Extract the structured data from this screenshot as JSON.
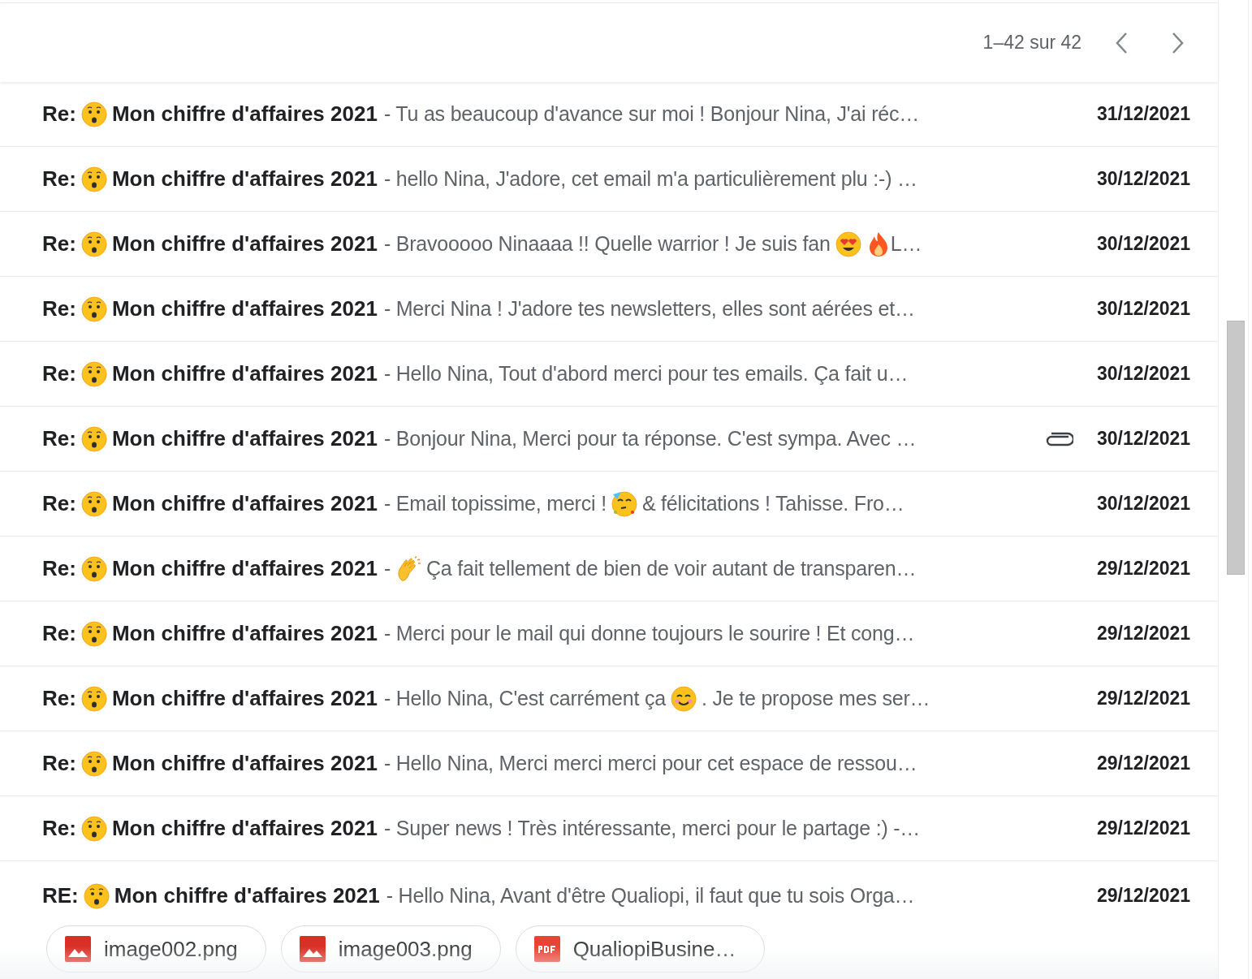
{
  "pagination": {
    "range": "1–42 sur 42"
  },
  "emails": [
    {
      "title": [
        {
          "kind": "text",
          "text": "Re:"
        },
        {
          "kind": "hushed"
        },
        {
          "kind": "text",
          "text": "Mon chiffre d'affaires 2021"
        }
      ],
      "snippet": [
        {
          "kind": "text",
          "text": "- Tu as beaucoup d'avance sur moi ! Bonjour Nina, J'ai réc…"
        }
      ],
      "has_attachment": false,
      "date": "31/12/2021"
    },
    {
      "title": [
        {
          "kind": "text",
          "text": "Re:"
        },
        {
          "kind": "hushed"
        },
        {
          "kind": "text",
          "text": "Mon chiffre d'affaires 2021"
        }
      ],
      "snippet": [
        {
          "kind": "text",
          "text": "- hello Nina, J'adore, cet email m'a particulièrement plu :-) …"
        }
      ],
      "has_attachment": false,
      "date": "30/12/2021"
    },
    {
      "title": [
        {
          "kind": "text",
          "text": "Re:"
        },
        {
          "kind": "hushed"
        },
        {
          "kind": "text",
          "text": "Mon chiffre d'affaires 2021"
        }
      ],
      "snippet": [
        {
          "kind": "text",
          "text": "- Bravooooo Ninaaaa !! Quelle warrior ! Je suis fan"
        },
        {
          "kind": "heart_eyes"
        },
        {
          "kind": "fire"
        },
        {
          "kind": "text",
          "text": "L…"
        }
      ],
      "has_attachment": false,
      "date": "30/12/2021"
    },
    {
      "title": [
        {
          "kind": "text",
          "text": "Re:"
        },
        {
          "kind": "hushed"
        },
        {
          "kind": "text",
          "text": "Mon chiffre d'affaires 2021"
        }
      ],
      "snippet": [
        {
          "kind": "text",
          "text": "- Merci Nina ! J'adore tes newsletters, elles sont aérées et…"
        }
      ],
      "has_attachment": false,
      "date": "30/12/2021"
    },
    {
      "title": [
        {
          "kind": "text",
          "text": "Re:"
        },
        {
          "kind": "hushed"
        },
        {
          "kind": "text",
          "text": "Mon chiffre d'affaires 2021"
        }
      ],
      "snippet": [
        {
          "kind": "text",
          "text": "- Hello Nina, Tout d'abord merci pour tes emails. Ça fait u…"
        }
      ],
      "has_attachment": false,
      "date": "30/12/2021"
    },
    {
      "title": [
        {
          "kind": "text",
          "text": "Re:"
        },
        {
          "kind": "hushed"
        },
        {
          "kind": "text",
          "text": "Mon chiffre d'affaires 2021"
        }
      ],
      "snippet": [
        {
          "kind": "text",
          "text": "- Bonjour Nina, Merci pour ta réponse. C'est sympa. Avec …"
        }
      ],
      "has_attachment": true,
      "date": "30/12/2021"
    },
    {
      "title": [
        {
          "kind": "text",
          "text": "Re:"
        },
        {
          "kind": "hushed"
        },
        {
          "kind": "text",
          "text": "Mon chiffre d'affaires 2021"
        }
      ],
      "snippet": [
        {
          "kind": "text",
          "text": "- Email topissime, merci !"
        },
        {
          "kind": "party"
        },
        {
          "kind": "text",
          "text": "& félicitations ! Tahisse. Fro…"
        }
      ],
      "has_attachment": false,
      "date": "30/12/2021"
    },
    {
      "title": [
        {
          "kind": "text",
          "text": "Re:"
        },
        {
          "kind": "hushed"
        },
        {
          "kind": "text",
          "text": "Mon chiffre d'affaires 2021"
        }
      ],
      "snippet": [
        {
          "kind": "text",
          "text": "-"
        },
        {
          "kind": "clap"
        },
        {
          "kind": "text",
          "text": "Ça fait tellement de bien de voir autant de transparen…"
        }
      ],
      "has_attachment": false,
      "date": "29/12/2021"
    },
    {
      "title": [
        {
          "kind": "text",
          "text": "Re:"
        },
        {
          "kind": "hushed"
        },
        {
          "kind": "text",
          "text": "Mon chiffre d'affaires 2021"
        }
      ],
      "snippet": [
        {
          "kind": "text",
          "text": "- Merci pour le mail qui donne toujours le sourire ! Et cong…"
        }
      ],
      "has_attachment": false,
      "date": "29/12/2021"
    },
    {
      "title": [
        {
          "kind": "text",
          "text": "Re:"
        },
        {
          "kind": "hushed"
        },
        {
          "kind": "text",
          "text": "Mon chiffre d'affaires 2021"
        }
      ],
      "snippet": [
        {
          "kind": "text",
          "text": "- Hello Nina, C'est carrément ça"
        },
        {
          "kind": "smile"
        },
        {
          "kind": "text",
          "text": ". Je te propose mes ser…"
        }
      ],
      "has_attachment": false,
      "date": "29/12/2021"
    },
    {
      "title": [
        {
          "kind": "text",
          "text": "Re:"
        },
        {
          "kind": "hushed"
        },
        {
          "kind": "text",
          "text": "Mon chiffre d'affaires 2021"
        }
      ],
      "snippet": [
        {
          "kind": "text",
          "text": "- Hello Nina, Merci merci merci pour cet espace de ressou…"
        }
      ],
      "has_attachment": false,
      "date": "29/12/2021"
    },
    {
      "title": [
        {
          "kind": "text",
          "text": "Re:"
        },
        {
          "kind": "hushed"
        },
        {
          "kind": "text",
          "text": "Mon chiffre d'affaires 2021"
        }
      ],
      "snippet": [
        {
          "kind": "text",
          "text": "- Super news ! Très intéressante, merci pour le partage :) -…"
        }
      ],
      "has_attachment": false,
      "date": "29/12/2021"
    },
    {
      "title": [
        {
          "kind": "text",
          "text": "RE:"
        },
        {
          "kind": "hushed"
        },
        {
          "kind": "text",
          "text": "Mon chiffre d'affaires 2021"
        }
      ],
      "snippet": [
        {
          "kind": "text",
          "text": "- Hello Nina, Avant d'être Qualiopi, il faut que tu sois Orga…"
        }
      ],
      "has_attachment": false,
      "date": "29/12/2021",
      "attachments": [
        {
          "kind": "image",
          "name": "image002.png"
        },
        {
          "kind": "image",
          "name": "image003.png"
        },
        {
          "kind": "pdf",
          "name": "QualiopiBusine…"
        }
      ]
    }
  ]
}
